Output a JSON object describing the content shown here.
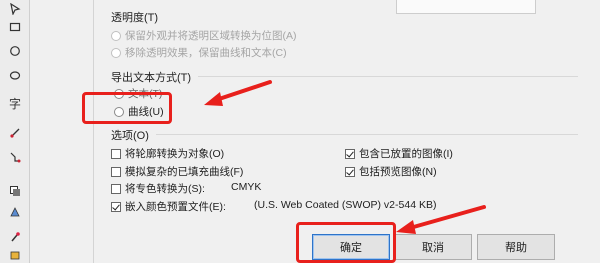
{
  "toolbox": {
    "icons": [
      "pick-tool-icon",
      "rectangle-tool-icon",
      "ellipse-tool-icon",
      "polygon-tool-icon",
      "text-tool-icon",
      "dimension-tool-icon",
      "connector-tool-icon",
      "shadow-tool-icon",
      "transparency-tool-icon",
      "eyedropper-tool-icon",
      "fill-tool-icon"
    ],
    "text_tool_glyph": "字"
  },
  "transparency": {
    "title": "透明度(T)",
    "options": [
      {
        "label": "保留外观并将透明区域转换为位图(A)",
        "enabled": false
      },
      {
        "label": "移除透明效果，保留曲线和文本(C)",
        "enabled": false
      }
    ]
  },
  "export_text": {
    "title": "导出文本方式(T)",
    "partial_option": "文本(T)",
    "curves_option": "曲线(U)"
  },
  "options": {
    "title": "选项(O)",
    "left": [
      {
        "label": "将轮廓转换为对象(O)",
        "checked": false
      },
      {
        "label": "模拟复杂的已填充曲线(F)",
        "checked": false
      },
      {
        "label": "将专色转换为(S):",
        "checked": false
      },
      {
        "label": "嵌入颜色预置文件(E):",
        "checked": true
      }
    ],
    "right": [
      {
        "label": "包含已放置的图像(I)",
        "checked": true
      },
      {
        "label": "包括预览图像(N)",
        "checked": true
      }
    ],
    "spot_color_value": "CMYK",
    "profile_value": "(U.S. Web Coated (SWOP) v2-544 KB)"
  },
  "buttons": {
    "ok": "确定",
    "cancel": "取消",
    "help": "帮助"
  },
  "annotation_color": "#e8201c"
}
